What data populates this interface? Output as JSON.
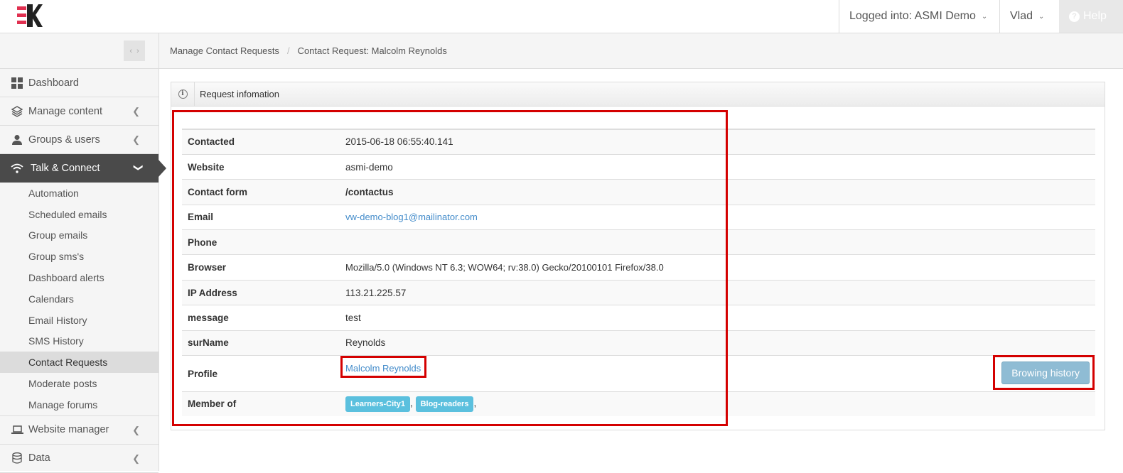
{
  "header": {
    "logged_into": "Logged into: ASMI Demo",
    "user": "Vlad",
    "help": "Help"
  },
  "sidebar": {
    "items": [
      {
        "label": "Dashboard"
      },
      {
        "label": "Manage content"
      },
      {
        "label": "Groups & users"
      },
      {
        "label": "Talk & Connect"
      }
    ],
    "sub_items": [
      "Automation",
      "Scheduled emails",
      "Group emails",
      "Group sms's",
      "Dashboard alerts",
      "Calendars",
      "Email History",
      "SMS History",
      "Contact Requests",
      "Moderate posts",
      "Manage forums"
    ],
    "bottom_items": [
      {
        "label": "Website manager"
      },
      {
        "label": "Data"
      }
    ]
  },
  "breadcrumb": {
    "parent": "Manage Contact Requests",
    "current": "Contact Request: Malcolm Reynolds"
  },
  "panel": {
    "title": "Request infomation"
  },
  "info": {
    "contacted": {
      "label": "Contacted",
      "value": "2015-06-18 06:55:40.141"
    },
    "website": {
      "label": "Website",
      "value": "asmi-demo"
    },
    "contact_form": {
      "label": "Contact form",
      "value": "/contactus"
    },
    "email": {
      "label": "Email",
      "value": "vw-demo-blog1@mailinator.com"
    },
    "phone": {
      "label": "Phone",
      "value": ""
    },
    "browser": {
      "label": "Browser",
      "value": "Mozilla/5.0 (Windows NT 6.3; WOW64; rv:38.0) Gecko/20100101 Firefox/38.0"
    },
    "ip": {
      "label": "IP Address",
      "value": "113.21.225.57"
    },
    "message": {
      "label": "message",
      "value": "test"
    },
    "surname": {
      "label": "surName",
      "value": "Reynolds"
    },
    "profile": {
      "label": "Profile",
      "value": "Malcolm Reynolds",
      "button": "Browing history"
    },
    "member_of": {
      "label": "Member of",
      "tags": [
        "Learners-City1",
        "Blog-readers"
      ],
      "separator": ","
    }
  },
  "colors": {
    "annotation": "#d40000",
    "active_nav": "#4a4a4a",
    "link": "#428bca",
    "tag": "#5bc0de"
  },
  "icons": [
    "grid-icon",
    "layers-icon",
    "user-icon",
    "wifi-icon",
    "laptop-icon",
    "database-icon",
    "chevron-left-icon",
    "chevron-down-icon",
    "info-icon",
    "question-icon"
  ]
}
